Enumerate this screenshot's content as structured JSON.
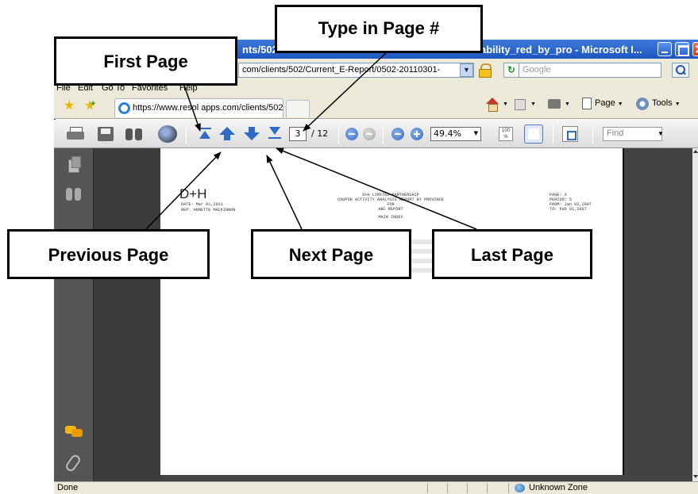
{
  "browser": {
    "title_left": "nts/502",
    "title_right": "ability_red_by_pro - Microsoft I...",
    "url": "com/clients/502/Current_E-Report/0502-20110301-",
    "search_placeholder": "Google",
    "menu": [
      "File",
      "Edit",
      "Go To",
      "Favorites",
      "Help"
    ],
    "tab_title": "https://www.resol  apps.com/clients/502/Curre  E-...",
    "cmd_page": "Page",
    "cmd_tools": "Tools",
    "status_left": "Done",
    "status_zone": "Unknown Zone"
  },
  "pdf_toolbar": {
    "current_page": "3",
    "total_pages": "/ 12",
    "zoom": "49.4%",
    "find_placeholder": "Find",
    "actual_size_text": "100 %"
  },
  "document": {
    "logo": "D+H",
    "date": "DATE: Mar 01,2011",
    "rep": "REP: ANNETTE MACKINNON",
    "company": "D+H LIMITED PARTNERSHIP",
    "report_title": "COUPON ACTIVITY ANALYSIS REPORT BY PROVINCE",
    "for": "FOR",
    "client": "ABC REPORT",
    "index": "MAIN INDEX",
    "page_label": "PAGE:      3",
    "period": "PERIOD:     5",
    "from": "FROM: Jan 02,2007",
    "to": "TO: Feb 01,2007"
  },
  "callouts": {
    "type_page": "Type in Page #",
    "first_page": "First Page",
    "previous_page": "Previous Page",
    "next_page": "Next Page",
    "last_page": "Last Page"
  }
}
